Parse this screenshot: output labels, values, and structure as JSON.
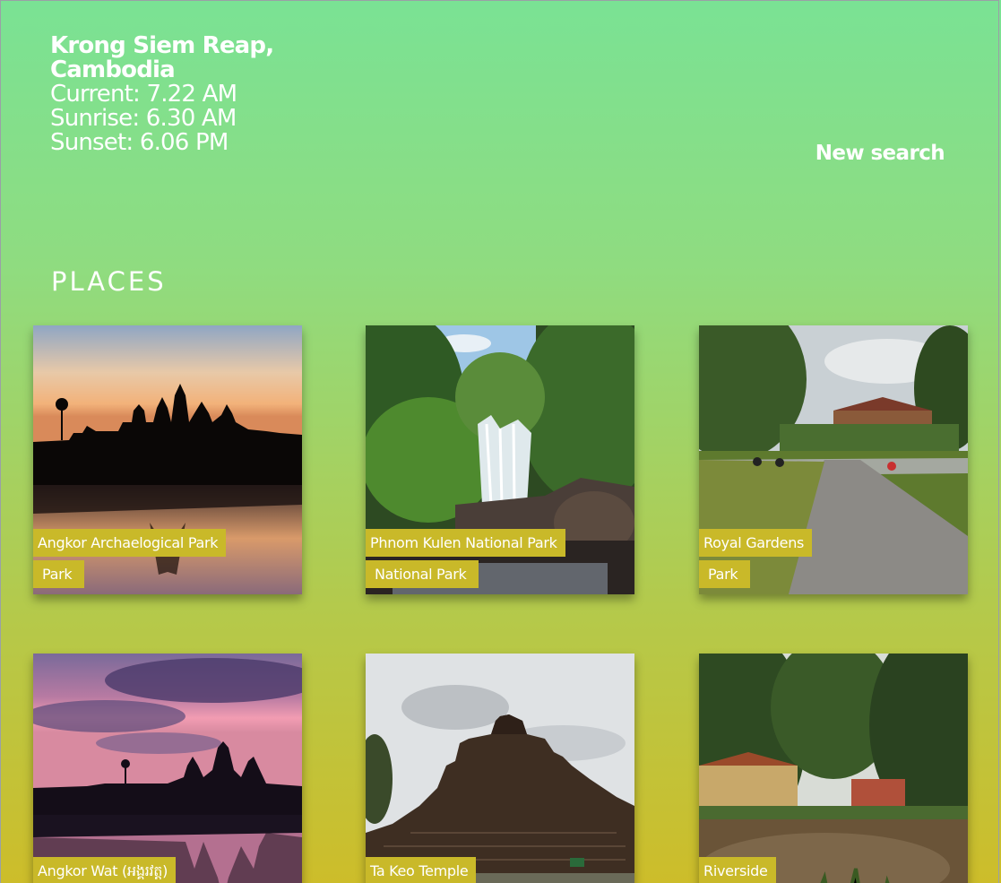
{
  "location": {
    "city": "Krong Siem Reap,",
    "country": "Cambodia",
    "current": "Current: 7.22 AM",
    "sunrise": "Sunrise: 6.30 AM",
    "sunset": "Sunset: 6.06 PM"
  },
  "actions": {
    "new_search": "New search"
  },
  "places": {
    "heading": "PLACES",
    "items": [
      {
        "name": "Angkor Archaelogical Park",
        "type": "Park",
        "photo": "angkor-sunset-silhouette"
      },
      {
        "name": "Phnom Kulen National Park",
        "type": "National Park",
        "photo": "waterfall-jungle"
      },
      {
        "name": "Royal Gardens",
        "type": "Park",
        "photo": "garden-path"
      },
      {
        "name": "Angkor Wat (អង្គរវត្ត)",
        "photo": "angkor-purple-dawn"
      },
      {
        "name": "Ta Keo Temple",
        "photo": "stone-temple-cloudy"
      },
      {
        "name": "Riverside",
        "photo": "river-trees"
      }
    ]
  },
  "colors": {
    "gradient_top": "#7ae294",
    "gradient_bottom": "#cdbd2a",
    "tag_bg": "#c9b929",
    "text": "#ffffff"
  }
}
